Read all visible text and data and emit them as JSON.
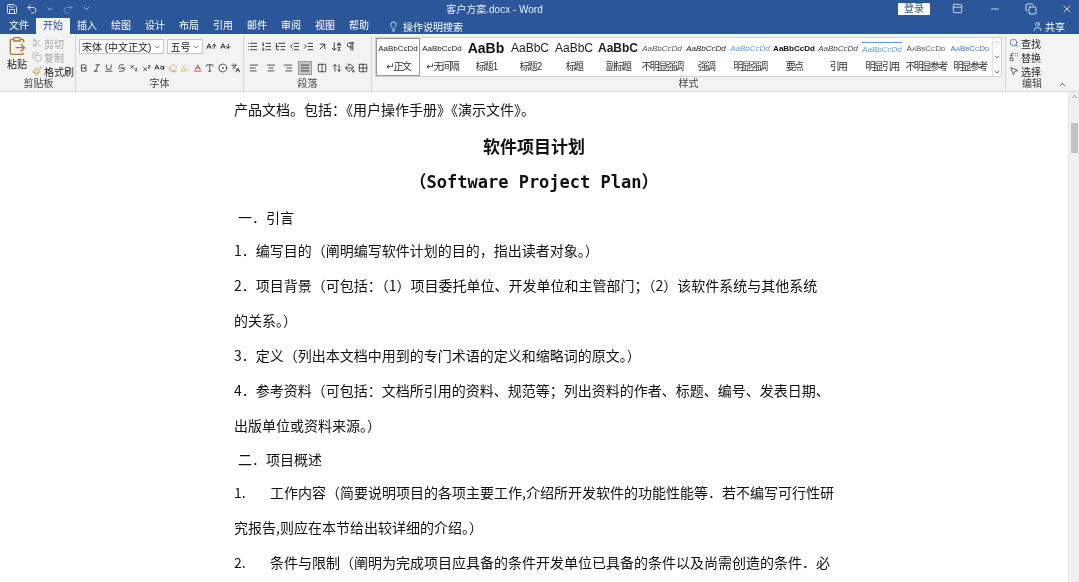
{
  "title_bar": {
    "title": "客户方案.docx - Word",
    "sign_in": "登录",
    "redo_disabled": true
  },
  "tabs": [
    {
      "label": "文件",
      "selected": false
    },
    {
      "label": "开始",
      "selected": true
    },
    {
      "label": "插入",
      "selected": false
    },
    {
      "label": "绘图",
      "selected": false
    },
    {
      "label": "设计",
      "selected": false
    },
    {
      "label": "布局",
      "selected": false
    },
    {
      "label": "引用",
      "selected": false
    },
    {
      "label": "邮件",
      "selected": false
    },
    {
      "label": "审阅",
      "selected": false
    },
    {
      "label": "视图",
      "selected": false
    },
    {
      "label": "帮助",
      "selected": false
    }
  ],
  "tell_me": "操作说明搜索",
  "share": "共享",
  "ribbon": {
    "clipboard": {
      "paste": "粘贴",
      "cut": "剪切",
      "cut_disabled": true,
      "copy": "复制",
      "copy_disabled": true,
      "format_painter": "格式刷",
      "label": "剪贴板"
    },
    "font": {
      "name": "宋体 (中文正文)",
      "size": "五号",
      "label": "字体"
    },
    "paragraph": {
      "label": "段落",
      "alignments": [
        {
          "kind": "left",
          "selected": false
        },
        {
          "kind": "center",
          "selected": false
        },
        {
          "kind": "right",
          "selected": false
        },
        {
          "kind": "justify",
          "selected": true
        },
        {
          "kind": "distributed",
          "selected": false
        }
      ]
    },
    "styles": {
      "label": "样式",
      "items": [
        {
          "preview": "AaBbCcDd",
          "name": "↵ 正文",
          "kind": "normal",
          "selected": true
        },
        {
          "preview": "AaBbCcDd",
          "name": "↵ 无间隔",
          "kind": "normal",
          "selected": false
        },
        {
          "preview": "AaBb",
          "name": "标题 1",
          "kind": "heading1",
          "selected": false
        },
        {
          "preview": "AaBbC",
          "name": "标题 2",
          "kind": "heading2",
          "selected": false
        },
        {
          "preview": "AaBbC",
          "name": "标题",
          "kind": "title",
          "selected": false
        },
        {
          "preview": "AaBbC",
          "name": "副标题",
          "kind": "subtitle",
          "selected": false
        },
        {
          "preview": "AaBbCcDd",
          "name": "不明显强调",
          "kind": "subtle-emphasis",
          "selected": false
        },
        {
          "preview": "AaBbCcDd",
          "name": "强调",
          "kind": "emphasis",
          "selected": false
        },
        {
          "preview": "AaBbCcDd",
          "name": "明显强调",
          "kind": "intense-emphasis",
          "selected": false
        },
        {
          "preview": "AaBbCcDd",
          "name": "要点",
          "kind": "strong",
          "selected": false
        },
        {
          "preview": "AaBbCcDd",
          "name": "引用",
          "kind": "quote",
          "selected": false
        },
        {
          "preview": "AaBbCcDd",
          "name": "明显引用",
          "kind": "intense-quote",
          "selected": false
        },
        {
          "preview": "AaBbCcDd",
          "name": "不明显参考",
          "kind": "subtle-reference",
          "selected": false
        },
        {
          "preview": "AaBbCcDd",
          "name": "明显参考",
          "kind": "intense-reference",
          "selected": false
        }
      ]
    },
    "editing": {
      "find": "查找",
      "replace": "替换",
      "select": "选择",
      "label": "编辑"
    }
  },
  "document": {
    "paragraphs": [
      {
        "kind": "body",
        "lines": [
          "产品文档。包括：《用户操作手册》《演示文件》。"
        ]
      },
      {
        "kind": "title",
        "lines": [
          "软件项目计划"
        ]
      },
      {
        "kind": "subtitle",
        "lines": [
          "（Software Project Plan）"
        ]
      },
      {
        "kind": "heading",
        "lines": [
          "一．引言"
        ]
      },
      {
        "kind": "body",
        "lines": [
          "1．编写目的（阐明编写软件计划的目的，指出读者对象。）"
        ]
      },
      {
        "kind": "body",
        "lines": [
          "2．项目背景（可包括：（1）项目委托单位、开发单位和主管部门；（2）该软件系统与其他系统",
          "的关系。）"
        ]
      },
      {
        "kind": "body",
        "lines": [
          "3．定义（列出本文档中用到的专门术语的定义和缩略词的原文。）"
        ]
      },
      {
        "kind": "body",
        "lines": [
          "4．参考资料（可包括：文档所引用的资料、规范等；列出资料的作者、标题、编号、发表日期、",
          "出版单位或资料来源。）"
        ]
      },
      {
        "kind": "heading",
        "lines": [
          "二．项目概述"
        ]
      },
      {
        "kind": "numbered",
        "number": "1.",
        "lines": [
          "工作内容（简要说明项目的各项主要工作,介绍所开发软件的功能性能等．若不编写可行性研",
          "究报告,则应在本节给出较详细的介绍。）"
        ]
      },
      {
        "kind": "numbered",
        "number": "2.",
        "lines": [
          "条件与限制（阐明为完成项目应具备的条件开发单位已具备的条件以及尚需创造的条件．必"
        ]
      }
    ]
  }
}
